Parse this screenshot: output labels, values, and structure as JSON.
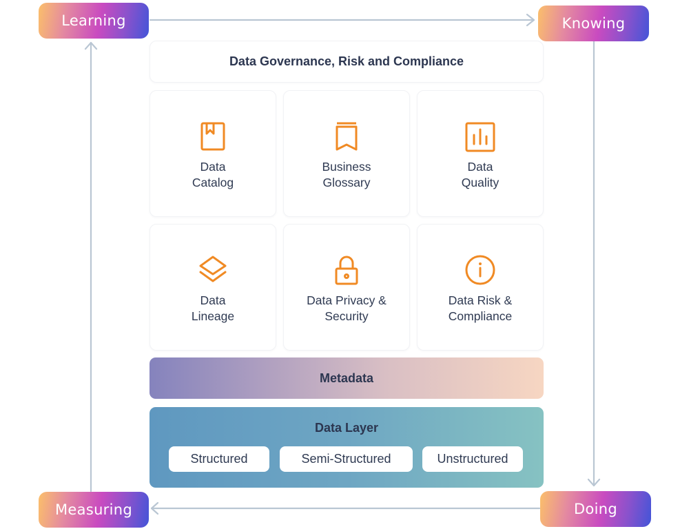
{
  "cycle": {
    "stages": [
      {
        "id": "learning",
        "label": "Learning"
      },
      {
        "id": "knowing",
        "label": "Knowing"
      },
      {
        "id": "doing",
        "label": "Doing"
      },
      {
        "id": "measuring",
        "label": "Measuring"
      }
    ],
    "gradient_colors": [
      "#fbbf6a",
      "#c94bc0",
      "#4355d8"
    ],
    "arrow_color": "#b9c6d3"
  },
  "framework": {
    "header": "Data Governance, Risk and Compliance",
    "tiles": [
      {
        "icon": "book-bookmark-icon",
        "line1": "Data",
        "line2": "Catalog"
      },
      {
        "icon": "bookmark-icon",
        "line1": "Business",
        "line2": "Glossary"
      },
      {
        "icon": "bar-chart-icon",
        "line1": "Data",
        "line2": "Quality"
      },
      {
        "icon": "layers-icon",
        "line1": "Data",
        "line2": "Lineage"
      },
      {
        "icon": "lock-icon",
        "line1": "Data Privacy &",
        "line2": "Security"
      },
      {
        "icon": "info-circle-icon",
        "line1": "Data Risk &",
        "line2": "Compliance"
      }
    ],
    "icon_color": "#f08a24",
    "metadata": "Metadata",
    "data_layer": {
      "title": "Data Layer",
      "types": [
        "Structured",
        "Semi-Structured",
        "Unstructured"
      ]
    }
  }
}
